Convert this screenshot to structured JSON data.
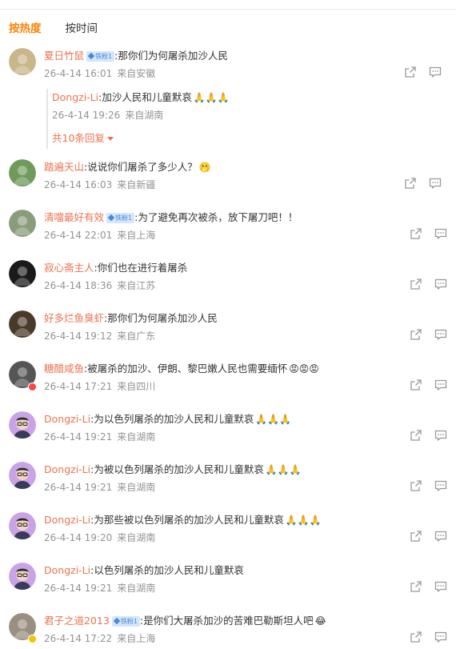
{
  "tabs": {
    "hot": "按热度",
    "time": "按时间"
  },
  "comments": [
    {
      "user": "夏日竹鼠",
      "badge": "铁粉1",
      "text": ":那你们为何屠杀加沙人民",
      "emoji": "",
      "time": "26-4-14 16:01",
      "source": "来自安徽",
      "avatar_color": "#c9b68a"
    },
    {
      "user": "踏遍天山",
      "badge": "",
      "text": ":说说你们屠杀了多少人？",
      "emoji": "🫢",
      "time": "26-4-14 16:03",
      "source": "来自新疆",
      "avatar_color": "#6f9a5a"
    },
    {
      "user": "清噹最好有效",
      "badge": "铁粉1",
      "text": ":为了避免再次被杀，放下屠刀吧！！",
      "emoji": "",
      "time": "26-4-14 22:01",
      "source": "来自上海",
      "avatar_color": "#8a9d7a"
    },
    {
      "user": "寂心斋主人",
      "badge": "",
      "text": ":你们也在进行着屠杀",
      "emoji": "",
      "time": "26-4-14 18:36",
      "source": "来自江苏",
      "avatar_color": "#1a1a1a"
    },
    {
      "user": "好多烂鱼臭虾",
      "badge": "",
      "text": ":那你们为何屠杀加沙人民",
      "emoji": "",
      "time": "26-4-14 19:12",
      "source": "来自广东",
      "avatar_color": "#4a3a2a"
    },
    {
      "user": "糖醋咸鱼",
      "badge": "",
      "text": ":被屠杀的加沙、伊朗、黎巴嫩人民也需要缅怀",
      "emoji": "😡😡😡",
      "time": "26-4-14 17:21",
      "source": "来自四川",
      "avatar_color": "#555555"
    },
    {
      "user": "Dongzi-Li",
      "badge": "",
      "text": ":为以色列屠杀的加沙人民和儿童默哀",
      "emoji": "🙏🙏🙏",
      "time": "26-4-14 19:21",
      "source": "来自湖南",
      "avatar_color": "#b88ad6"
    },
    {
      "user": "Dongzi-Li",
      "badge": "",
      "text": ":为被以色列屠杀的加沙人民和儿童默哀",
      "emoji": "🙏🙏🙏",
      "time": "26-4-14 19:21",
      "source": "来自湖南",
      "avatar_color": "#b88ad6"
    },
    {
      "user": "Dongzi-Li",
      "badge": "",
      "text": ":为那些被以色列屠杀的加沙人民和儿童默哀",
      "emoji": "🙏🙏🙏",
      "time": "26-4-14 19:20",
      "source": "来自湖南",
      "avatar_color": "#b88ad6"
    },
    {
      "user": "Dongzi-Li",
      "badge": "",
      "text": ":以色列屠杀的加沙人民和儿童默哀",
      "emoji": "",
      "time": "26-4-14 19:21",
      "source": "来自湖南",
      "avatar_color": "#b88ad6"
    },
    {
      "user": "君子之道2013",
      "badge": "铁粉1",
      "text": ":是你们大屠杀加沙的苦难巴勒斯坦人吧",
      "emoji": "😂",
      "time": "26-4-14 17:22",
      "source": "来自上海",
      "avatar_color": "#9a8f80"
    }
  ],
  "reply": {
    "user": "Dongzi-Li",
    "text": ":加沙人民和儿童默哀",
    "emoji": "🙏🙏🙏",
    "time": "26-4-14 19:26",
    "source": "来自湖南",
    "more": "共10条回复"
  },
  "icons": {
    "share": "share-icon",
    "comment": "comment-icon"
  },
  "colors": {
    "accent": "#ff8200",
    "username": "#eb7350",
    "meta": "#939393"
  }
}
